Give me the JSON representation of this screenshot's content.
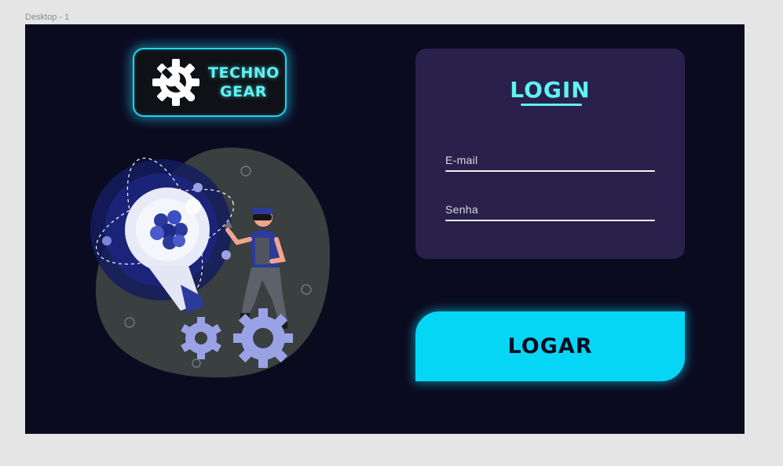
{
  "frame": {
    "label": "Desktop - 1"
  },
  "logo": {
    "line1": "TECHNO",
    "line2": "GEAR",
    "icon": "gear-wrench-icon"
  },
  "login": {
    "title": "LOGIN",
    "email_placeholder": "E-mail",
    "password_placeholder": "Senha",
    "submit_label": "LOGAR"
  },
  "colors": {
    "background": "#0b0b20",
    "panel": "#29214b",
    "accent": "#5ff3f3",
    "button": "#06d6f5"
  }
}
